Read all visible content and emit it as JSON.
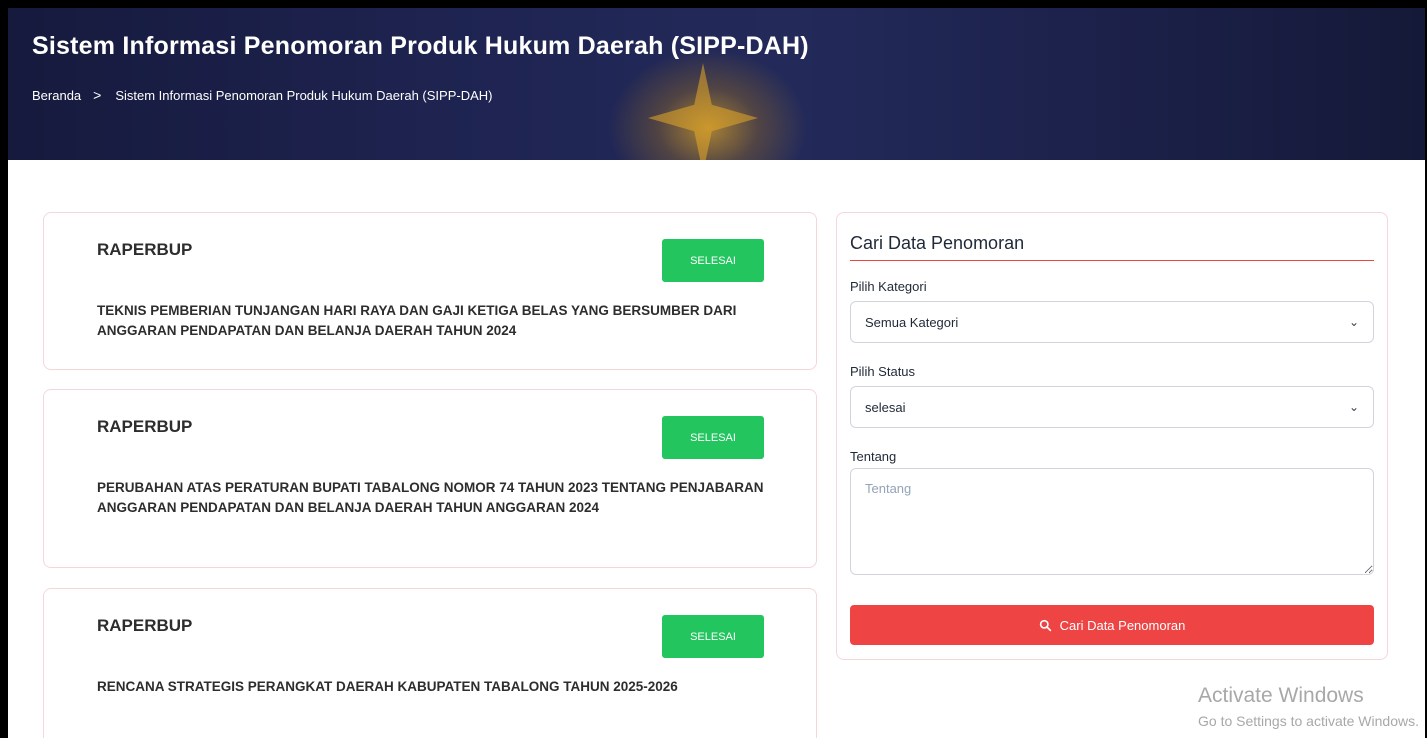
{
  "header": {
    "title": "Sistem Informasi Penomoran Produk Hukum Daerah (SIPP-DAH)",
    "breadcrumb": {
      "home": "Beranda",
      "separator": ">",
      "current": "Sistem Informasi Penomoran Produk Hukum Daerah (SIPP-DAH)"
    }
  },
  "results": [
    {
      "category": "RAPERBUP",
      "status": "SELESAI",
      "description": "TEKNIS PEMBERIAN TUNJANGAN HARI RAYA DAN GAJI KETIGA BELAS YANG BERSUMBER DARI ANGGARAN PENDAPATAN DAN BELANJA DAERAH TAHUN 2024"
    },
    {
      "category": "RAPERBUP",
      "status": "SELESAI",
      "description": "PERUBAHAN ATAS PERATURAN BUPATI TABALONG NOMOR 74 TAHUN 2023 TENTANG PENJABARAN ANGGARAN PENDAPATAN DAN BELANJA DAERAH TAHUN ANGGARAN 2024"
    },
    {
      "category": "RAPERBUP",
      "status": "SELESAI",
      "description": "RENCANA STRATEGIS PERANGKAT DAERAH KABUPATEN TABALONG TAHUN 2025-2026"
    }
  ],
  "search_panel": {
    "title": "Cari Data Penomoran",
    "category_label": "Pilih Kategori",
    "category_value": "Semua Kategori",
    "status_label": "Pilih Status",
    "status_value": "selesai",
    "about_label": "Tentang",
    "about_placeholder": "Tentang",
    "submit_label": "Cari Data Penomoran",
    "submit_icon": "search-icon"
  },
  "watermark": {
    "line1": "Activate Windows",
    "line2": "Go to Settings to activate Windows."
  },
  "colors": {
    "header_bg": "#1e2350",
    "badge_green": "#22c55e",
    "accent_red": "#ef4444",
    "card_border": "#f5d6d9"
  }
}
